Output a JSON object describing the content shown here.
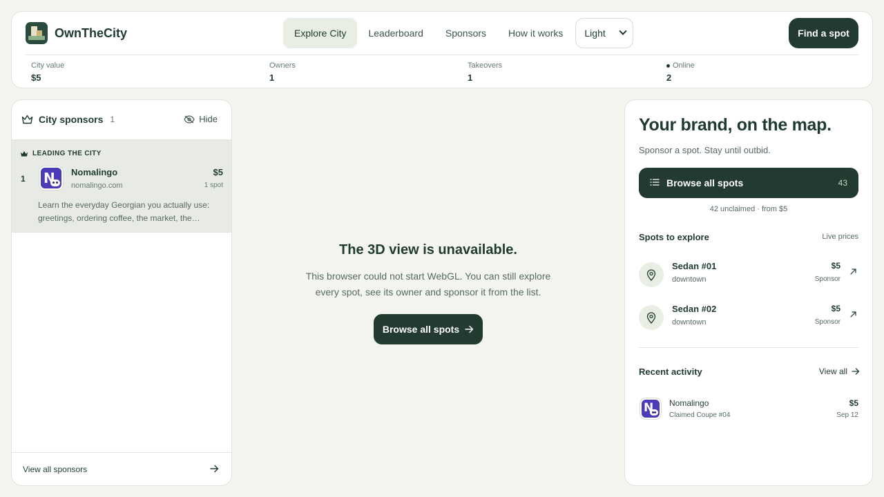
{
  "header": {
    "brand": "OwnTheCity",
    "nav": [
      "Explore City",
      "Leaderboard",
      "Sponsors",
      "How it works"
    ],
    "theme_value": "Light",
    "find_button": "Find a spot"
  },
  "stats": [
    {
      "label": "City value",
      "value": "$5"
    },
    {
      "label": "Owners",
      "value": "1"
    },
    {
      "label": "Takeovers",
      "value": "1"
    },
    {
      "label": "Online",
      "value": "2"
    }
  ],
  "sponsors": {
    "title": "City sponsors",
    "count": "1",
    "hide_label": "Hide",
    "leading_label": "LEADING THE CITY",
    "top": {
      "rank": "1",
      "name": "Nomalingo",
      "domain": "nomalingo.com",
      "price": "$5",
      "spots": "1 spot",
      "description": "Learn the everyday Georgian you actually use: greetings, ordering coffee, the market, the…"
    },
    "view_all": "View all sponsors"
  },
  "center": {
    "title": "The 3D view is unavailable.",
    "description": "This browser could not start WebGL. You can still explore every spot, see its owner and sponsor it from the list.",
    "button": "Browse all spots"
  },
  "promo": {
    "title": "Your brand, on the map.",
    "subtitle": "Sponsor a spot. Stay until outbid.",
    "browse_label": "Browse all spots",
    "browse_count": "43",
    "unclaimed": "42 unclaimed · from $5",
    "spots_title": "Spots to explore",
    "spots_note": "Live prices",
    "spots": [
      {
        "name": "Sedan #01",
        "area": "downtown",
        "price": "$5",
        "type": "Sponsor"
      },
      {
        "name": "Sedan #02",
        "area": "downtown",
        "price": "$5",
        "type": "Sponsor"
      }
    ],
    "activity_title": "Recent activity",
    "activity_view_all": "View all",
    "activity": {
      "name": "Nomalingo",
      "desc": "Claimed Coupe #04",
      "price": "$5",
      "date": "Sep 12"
    }
  },
  "colors": {
    "accent": "#223a30",
    "active_tab": "#e8eee3",
    "background": "#f4f5ef"
  }
}
